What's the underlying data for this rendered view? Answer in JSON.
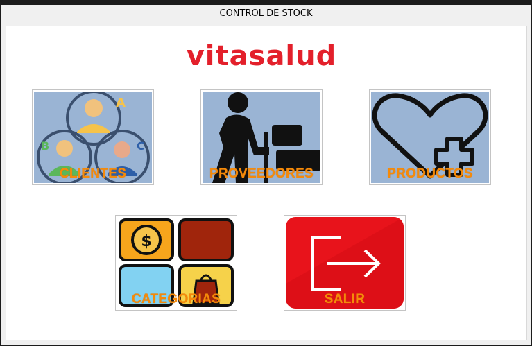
{
  "window": {
    "title": "CONTROL DE STOCK"
  },
  "logo": {
    "text": "vitasalud",
    "color": "#e3202b"
  },
  "menu": {
    "clientes": "CLIENTES",
    "proveedores": "PROVEEDORES",
    "productos": "PRODUCTOS",
    "categorias": "CATEGORIAS",
    "salir": "SALIR"
  },
  "colors": {
    "label": "#f58a0a",
    "tile_bg": "#9ab4d4",
    "exit_red": "#e8131b"
  }
}
